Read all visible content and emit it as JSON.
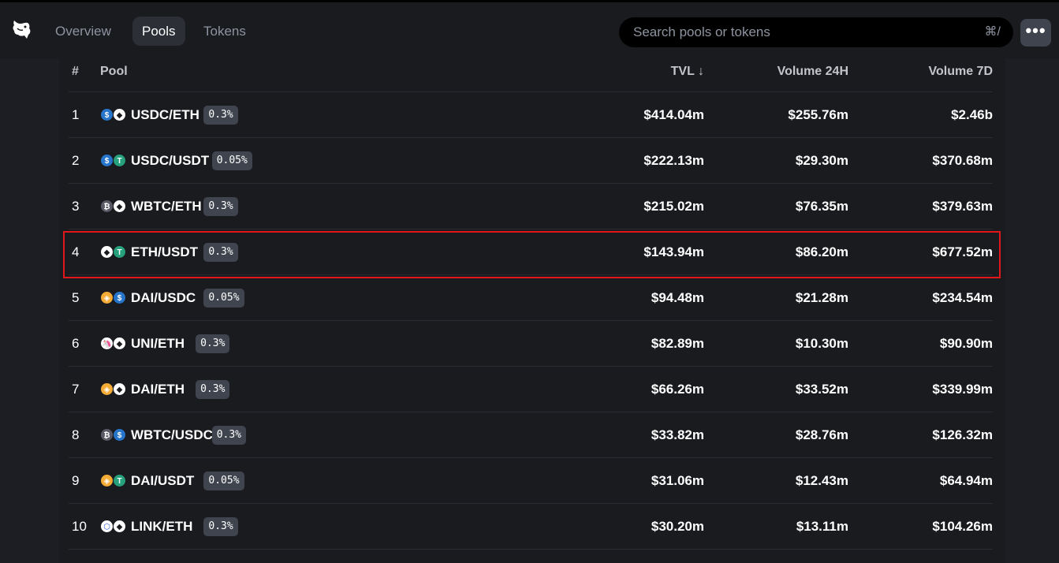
{
  "nav": {
    "logo_icon": "unicorn-logo-icon",
    "tabs": [
      {
        "label": "Overview",
        "active": false
      },
      {
        "label": "Pools",
        "active": true
      },
      {
        "label": "Tokens",
        "active": false
      }
    ]
  },
  "search": {
    "placeholder": "Search pools or tokens",
    "shortcut": "⌘/"
  },
  "more_button": {
    "label": "•••"
  },
  "table": {
    "headers": {
      "num": "#",
      "pool": "Pool",
      "tvl": "TVL ↓",
      "volume_24h": "Volume 24H",
      "volume_7d": "Volume 7D"
    },
    "rows": [
      {
        "num": "1",
        "pool": "USDC/ETH",
        "fee": "0.3%",
        "tvl": "$414.04m",
        "v24": "$255.76m",
        "v7": "$2.46b",
        "tokens": [
          "usdc",
          "eth"
        ]
      },
      {
        "num": "2",
        "pool": "USDC/USDT",
        "fee": "0.05%",
        "tvl": "$222.13m",
        "v24": "$29.30m",
        "v7": "$370.68m",
        "tokens": [
          "usdc",
          "usdt"
        ]
      },
      {
        "num": "3",
        "pool": "WBTC/ETH",
        "fee": "0.3%",
        "tvl": "$215.02m",
        "v24": "$76.35m",
        "v7": "$379.63m",
        "tokens": [
          "wbtc",
          "eth"
        ]
      },
      {
        "num": "4",
        "pool": "ETH/USDT",
        "fee": "0.3%",
        "tvl": "$143.94m",
        "v24": "$86.20m",
        "v7": "$677.52m",
        "tokens": [
          "eth",
          "usdt"
        ]
      },
      {
        "num": "5",
        "pool": "DAI/USDC",
        "fee": "0.05%",
        "tvl": "$94.48m",
        "v24": "$21.28m",
        "v7": "$234.54m",
        "tokens": [
          "dai",
          "usdc"
        ]
      },
      {
        "num": "6",
        "pool": "UNI/ETH",
        "fee": "0.3%",
        "tvl": "$82.89m",
        "v24": "$10.30m",
        "v7": "$90.90m",
        "tokens": [
          "uni",
          "eth"
        ]
      },
      {
        "num": "7",
        "pool": "DAI/ETH",
        "fee": "0.3%",
        "tvl": "$66.26m",
        "v24": "$33.52m",
        "v7": "$339.99m",
        "tokens": [
          "dai",
          "eth"
        ]
      },
      {
        "num": "8",
        "pool": "WBTC/USDC",
        "fee": "0.3%",
        "tvl": "$33.82m",
        "v24": "$28.76m",
        "v7": "$126.32m",
        "tokens": [
          "wbtc",
          "usdc"
        ]
      },
      {
        "num": "9",
        "pool": "DAI/USDT",
        "fee": "0.05%",
        "tvl": "$31.06m",
        "v24": "$12.43m",
        "v7": "$64.94m",
        "tokens": [
          "dai",
          "usdt"
        ]
      },
      {
        "num": "10",
        "pool": "LINK/ETH",
        "fee": "0.3%",
        "tvl": "$30.20m",
        "v24": "$13.11m",
        "v7": "$104.26m",
        "tokens": [
          "link",
          "eth"
        ]
      }
    ],
    "highlighted_row": "4"
  },
  "token_styles": {
    "usdc": {
      "bg": "#2775ca",
      "fg": "#ffffff",
      "glyph": "$"
    },
    "eth": {
      "bg": "#ffffff",
      "fg": "#1a1b1f",
      "glyph": "◆"
    },
    "usdt": {
      "bg": "#26a17b",
      "fg": "#ffffff",
      "glyph": "T"
    },
    "wbtc": {
      "bg": "#5a5a66",
      "fg": "#ffffff",
      "glyph": "₿"
    },
    "dai": {
      "bg": "#f5ac37",
      "fg": "#ffffff",
      "glyph": "◈"
    },
    "uni": {
      "bg": "#ffffff",
      "fg": "#ff007a",
      "glyph": "🦄"
    },
    "link": {
      "bg": "#ffffff",
      "fg": "#2a5ada",
      "glyph": "⬡"
    }
  },
  "colors": {
    "highlight": "#e0161a",
    "fee_badge": "#40444f"
  }
}
